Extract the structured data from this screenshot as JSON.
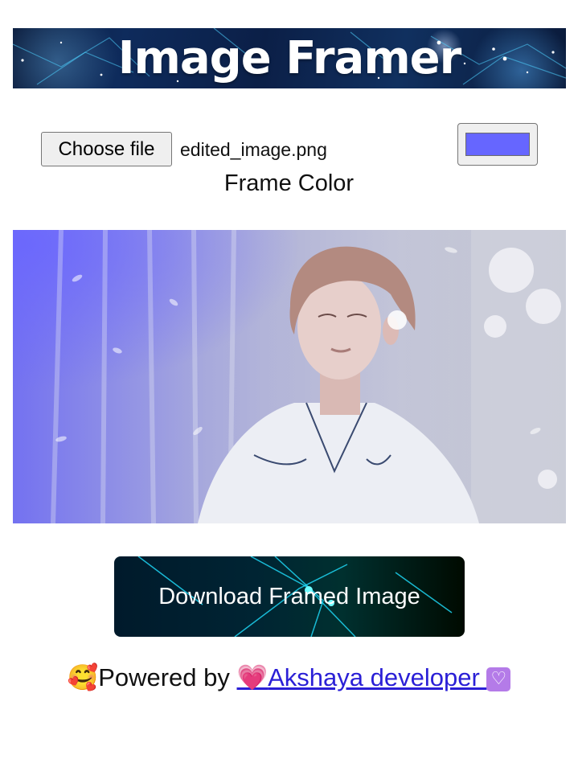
{
  "header": {
    "title": "Image Framer"
  },
  "file_input": {
    "button_label": "Choose file",
    "file_name": "edited_image.png"
  },
  "frame_color": {
    "label": "Frame Color",
    "value": "#6666ff"
  },
  "preview": {
    "icon": "framed-image-preview"
  },
  "download": {
    "label": "Download Framed Image"
  },
  "footer": {
    "prefix_emoji": "🥰",
    "prefix_text": "Powered by ",
    "link_emoji": "💗",
    "link_text": "Akshaya developer ",
    "link_suffix_emoji": "♡"
  },
  "colors": {
    "frame": "#6666ff",
    "link": "#2a1fd6",
    "banner_text": "#ffffff"
  }
}
